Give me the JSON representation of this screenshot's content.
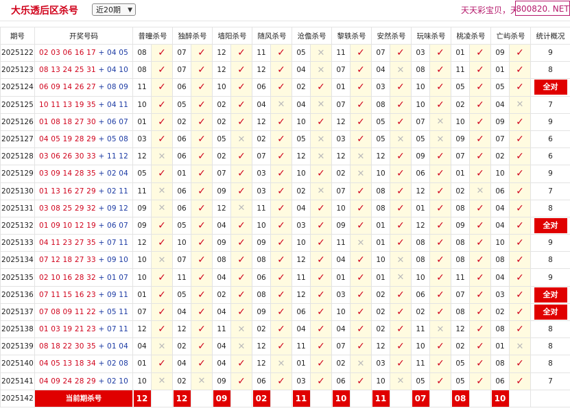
{
  "header": {
    "title": "大乐透后区杀号",
    "period_select": "近20期",
    "marquee": "天天彩宝贝，天",
    "domain": "800820. NET"
  },
  "columns": {
    "issue": "期号",
    "draw": "开奖号码",
    "experts": [
      "昔曈杀号",
      "独醉杀号",
      "墙阳杀号",
      "随风杀号",
      "沧儋杀号",
      "黎轶杀号",
      "安然杀号",
      "玩味杀号",
      "桃凌杀号",
      "亡屿杀号"
    ],
    "stat": "统计概况"
  },
  "rows": [
    {
      "issue": "2025122",
      "front": "02 03 06 16 17",
      "back": "04 05",
      "kills": [
        "08",
        "07",
        "12",
        "11",
        "05",
        "11",
        "07",
        "03",
        "01",
        "09"
      ],
      "res": [
        "t",
        "t",
        "t",
        "t",
        "x",
        "t",
        "t",
        "t",
        "t",
        "t"
      ],
      "stat": "9"
    },
    {
      "issue": "2025123",
      "front": "08 13 24 25 31",
      "back": "04 10",
      "kills": [
        "08",
        "07",
        "12",
        "12",
        "04",
        "07",
        "04",
        "08",
        "11",
        "01"
      ],
      "res": [
        "t",
        "t",
        "t",
        "t",
        "x",
        "t",
        "x",
        "t",
        "t",
        "t"
      ],
      "stat": "8"
    },
    {
      "issue": "2025124",
      "front": "06 09 14 26 27",
      "back": "08 09",
      "kills": [
        "11",
        "06",
        "10",
        "06",
        "02",
        "01",
        "03",
        "10",
        "05",
        "05"
      ],
      "res": [
        "t",
        "t",
        "t",
        "t",
        "t",
        "t",
        "t",
        "t",
        "t",
        "t"
      ],
      "stat": "全对"
    },
    {
      "issue": "2025125",
      "front": "10 11 13 19 35",
      "back": "04 11",
      "kills": [
        "10",
        "05",
        "02",
        "04",
        "04",
        "07",
        "08",
        "10",
        "02",
        "04"
      ],
      "res": [
        "t",
        "t",
        "t",
        "x",
        "x",
        "t",
        "t",
        "t",
        "t",
        "x"
      ],
      "stat": "7"
    },
    {
      "issue": "2025126",
      "front": "01 08 18 27 30",
      "back": "06 07",
      "kills": [
        "01",
        "02",
        "02",
        "12",
        "10",
        "12",
        "05",
        "07",
        "10",
        "09"
      ],
      "res": [
        "t",
        "t",
        "t",
        "t",
        "t",
        "t",
        "t",
        "x",
        "t",
        "t"
      ],
      "stat": "9"
    },
    {
      "issue": "2025127",
      "front": "04 05 19 28 29",
      "back": "05 08",
      "kills": [
        "03",
        "06",
        "05",
        "02",
        "05",
        "03",
        "05",
        "05",
        "09",
        "07"
      ],
      "res": [
        "t",
        "t",
        "x",
        "t",
        "x",
        "t",
        "x",
        "x",
        "t",
        "t"
      ],
      "stat": "6"
    },
    {
      "issue": "2025128",
      "front": "03 06 26 30 33",
      "back": "11 12",
      "kills": [
        "12",
        "06",
        "02",
        "07",
        "12",
        "12",
        "12",
        "09",
        "07",
        "02"
      ],
      "res": [
        "x",
        "t",
        "t",
        "t",
        "x",
        "x",
        "t",
        "t",
        "t",
        "t"
      ],
      "stat": "6"
    },
    {
      "issue": "2025129",
      "front": "03 09 14 28 35",
      "back": "02 04",
      "kills": [
        "05",
        "01",
        "07",
        "03",
        "10",
        "02",
        "10",
        "06",
        "01",
        "10"
      ],
      "res": [
        "t",
        "t",
        "t",
        "t",
        "t",
        "x",
        "t",
        "t",
        "t",
        "t"
      ],
      "stat": "9"
    },
    {
      "issue": "2025130",
      "front": "01 13 16 27 29",
      "back": "02 11",
      "kills": [
        "11",
        "06",
        "09",
        "03",
        "02",
        "07",
        "08",
        "12",
        "02",
        "06"
      ],
      "res": [
        "x",
        "t",
        "t",
        "t",
        "x",
        "t",
        "t",
        "t",
        "x",
        "t"
      ],
      "stat": "7"
    },
    {
      "issue": "2025131",
      "front": "03 08 25 29 32",
      "back": "09 12",
      "kills": [
        "09",
        "06",
        "12",
        "11",
        "04",
        "10",
        "08",
        "01",
        "08",
        "04"
      ],
      "res": [
        "x",
        "t",
        "x",
        "t",
        "t",
        "t",
        "t",
        "t",
        "t",
        "t"
      ],
      "stat": "8"
    },
    {
      "issue": "2025132",
      "front": "01 09 10 12 19",
      "back": "06 07",
      "kills": [
        "09",
        "05",
        "04",
        "10",
        "03",
        "09",
        "01",
        "12",
        "09",
        "04"
      ],
      "res": [
        "t",
        "t",
        "t",
        "t",
        "t",
        "t",
        "t",
        "t",
        "t",
        "t"
      ],
      "stat": "全对"
    },
    {
      "issue": "2025133",
      "front": "04 11 23 27 35",
      "back": "07 11",
      "kills": [
        "12",
        "10",
        "09",
        "09",
        "10",
        "11",
        "01",
        "08",
        "08",
        "10"
      ],
      "res": [
        "t",
        "t",
        "t",
        "t",
        "t",
        "x",
        "t",
        "t",
        "t",
        "t"
      ],
      "stat": "9"
    },
    {
      "issue": "2025134",
      "front": "07 12 18 27 33",
      "back": "09 10",
      "kills": [
        "10",
        "07",
        "08",
        "08",
        "12",
        "04",
        "10",
        "08",
        "08",
        "08"
      ],
      "res": [
        "x",
        "t",
        "t",
        "t",
        "t",
        "t",
        "x",
        "t",
        "t",
        "t"
      ],
      "stat": "8"
    },
    {
      "issue": "2025135",
      "front": "02 10 16 28 32",
      "back": "01 07",
      "kills": [
        "10",
        "11",
        "04",
        "06",
        "11",
        "01",
        "01",
        "10",
        "11",
        "04"
      ],
      "res": [
        "t",
        "t",
        "t",
        "t",
        "t",
        "t",
        "x",
        "t",
        "t",
        "t"
      ],
      "stat": "9"
    },
    {
      "issue": "2025136",
      "front": "07 11 15 16 23",
      "back": "09 11",
      "kills": [
        "01",
        "05",
        "02",
        "08",
        "12",
        "03",
        "02",
        "06",
        "07",
        "03"
      ],
      "res": [
        "t",
        "t",
        "t",
        "t",
        "t",
        "t",
        "t",
        "t",
        "t",
        "t"
      ],
      "stat": "全对"
    },
    {
      "issue": "2025137",
      "front": "07 08 09 11 22",
      "back": "05 11",
      "kills": [
        "07",
        "04",
        "04",
        "09",
        "06",
        "10",
        "02",
        "02",
        "08",
        "02"
      ],
      "res": [
        "t",
        "t",
        "t",
        "t",
        "t",
        "t",
        "t",
        "t",
        "t",
        "t"
      ],
      "stat": "全对"
    },
    {
      "issue": "2025138",
      "front": "01 03 19 21 23",
      "back": "07 11",
      "kills": [
        "12",
        "12",
        "11",
        "02",
        "04",
        "04",
        "02",
        "11",
        "12",
        "08"
      ],
      "res": [
        "t",
        "t",
        "x",
        "t",
        "t",
        "t",
        "t",
        "x",
        "t",
        "t"
      ],
      "stat": "8"
    },
    {
      "issue": "2025139",
      "front": "08 18 22 30 35",
      "back": "01 04",
      "kills": [
        "04",
        "02",
        "04",
        "12",
        "11",
        "07",
        "12",
        "10",
        "02",
        "01"
      ],
      "res": [
        "x",
        "t",
        "x",
        "t",
        "t",
        "t",
        "t",
        "t",
        "t",
        "x"
      ],
      "stat": "8"
    },
    {
      "issue": "2025140",
      "front": "04 05 13 18 34",
      "back": "02 08",
      "kills": [
        "01",
        "04",
        "04",
        "12",
        "01",
        "02",
        "03",
        "11",
        "05",
        "08"
      ],
      "res": [
        "t",
        "t",
        "t",
        "x",
        "t",
        "x",
        "t",
        "t",
        "t",
        "t"
      ],
      "stat": "8"
    },
    {
      "issue": "2025141",
      "front": "04 09 24 28 29",
      "back": "02 10",
      "kills": [
        "10",
        "02",
        "09",
        "06",
        "03",
        "06",
        "10",
        "05",
        "05",
        "06"
      ],
      "res": [
        "x",
        "x",
        "t",
        "t",
        "t",
        "t",
        "x",
        "t",
        "t",
        "t"
      ],
      "stat": "7"
    }
  ],
  "current": {
    "issue": "2025142",
    "label": "当前期杀号",
    "kills": [
      "12",
      "12",
      "09",
      "02",
      "11",
      "10",
      "11",
      "07",
      "08",
      "10"
    ]
  },
  "colors": {
    "accent": "#e00000",
    "tick": "#d0021b",
    "cross": "#bbbbbb",
    "mark_bg": "#fffbe0",
    "back_blue": "#1b3aa3",
    "brand": "#b5186b"
  },
  "icons": {
    "tick": "check-icon",
    "cross": "cross-icon",
    "dropdown": "chevron-down-icon"
  }
}
